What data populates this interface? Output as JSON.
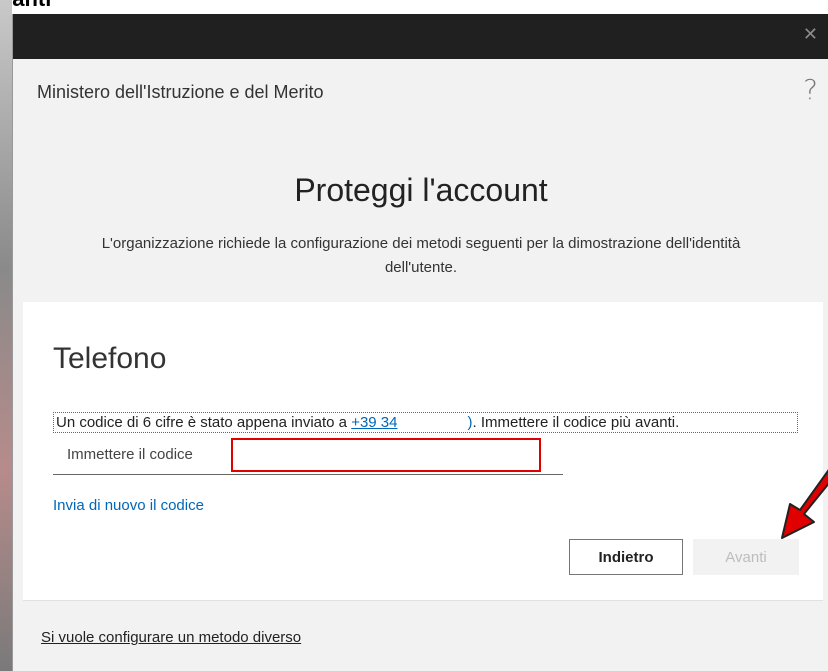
{
  "caption": "vanti",
  "window": {
    "close_glyph": "✕",
    "organization": "Ministero dell'Istruzione e del Merito",
    "help_glyph": "?"
  },
  "page": {
    "heading": "Proteggi l'account",
    "subtitle_line1": "L'organizzazione richiede la configurazione dei metodi seguenti per la dimostrazione dell'identità",
    "subtitle_line2": "dell'utente."
  },
  "method": {
    "title": "Telefono",
    "info_prefix": "Un codice di 6 cifre è stato appena inviato a ",
    "phone": "+39 34",
    "info_paren": ")",
    "info_suffix": ". Immettere il codice più avanti.",
    "code_label": "Immettere il codice",
    "code_value": "",
    "resend_label": "Invia di nuovo il codice",
    "back_label": "Indietro",
    "next_label": "Avanti"
  },
  "footer": {
    "other_method_link": "Si vuole configurare un metodo diverso"
  },
  "annotation": {
    "arrow_icon": "red-arrow-icon",
    "arrow_color": "#e00000",
    "input_highlight_color": "#e00000"
  }
}
